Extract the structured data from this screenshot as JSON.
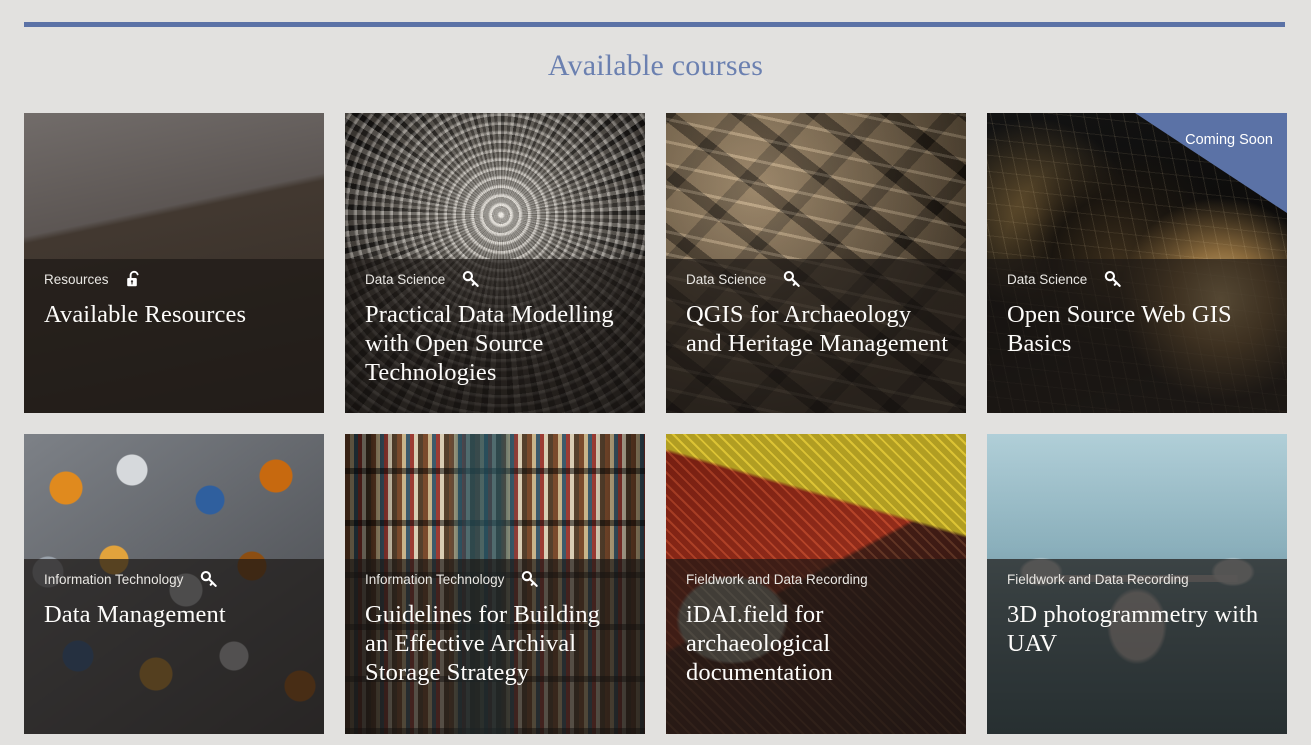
{
  "theme": {
    "page_background": "#e2e1df",
    "accent_blue": "#5b72a6",
    "heading_color": "#6b80b0",
    "card_text_color": "#fdfcfa"
  },
  "header": {
    "title": "Available courses"
  },
  "courses": [
    {
      "category": "Resources",
      "title": "Available Resources",
      "access_icon": "unlock-icon",
      "badge": null,
      "image": "books-spines"
    },
    {
      "category": "Data Science",
      "title": "Practical Data Modelling with Open Source Technologies",
      "access_icon": "key-icon",
      "badge": null,
      "image": "vortex"
    },
    {
      "category": "Data Science",
      "title": "QGIS for Archaeology and Heritage Management",
      "access_icon": "key-icon",
      "badge": null,
      "image": "old-maps"
    },
    {
      "category": "Data Science",
      "title": "Open Source Web GIS Basics",
      "access_icon": "key-icon",
      "badge": "Coming Soon",
      "image": "globes"
    },
    {
      "category": "Information Technology",
      "title": "Data Management",
      "access_icon": "key-icon",
      "badge": null,
      "image": "puzzle"
    },
    {
      "category": "Information Technology",
      "title": "Guidelines for Building an Effective Archival Storage Strategy",
      "access_icon": "key-icon",
      "badge": null,
      "image": "bookshelf"
    },
    {
      "category": "Fieldwork and Data Recording",
      "title": "iDAI.field for archaeological documentation",
      "access_icon": null,
      "badge": null,
      "image": "fieldnotes"
    },
    {
      "category": "Fieldwork and Data Recording",
      "title": "3D photogrammetry with UAV",
      "access_icon": null,
      "badge": null,
      "image": "drone"
    }
  ]
}
